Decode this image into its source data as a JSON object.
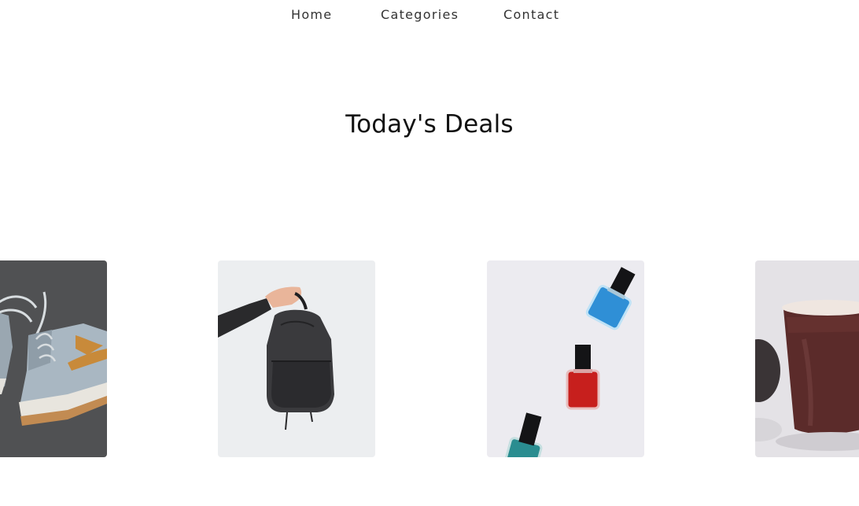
{
  "nav": {
    "items": [
      {
        "label": "Home"
      },
      {
        "label": "Categories"
      },
      {
        "label": "Contact"
      }
    ]
  },
  "deals": {
    "title": "Today's Deals",
    "products": [
      {
        "icon": "sneakers-image"
      },
      {
        "icon": "backpack-image"
      },
      {
        "icon": "nail-polish-image"
      },
      {
        "icon": "mug-image"
      }
    ]
  },
  "colors": {
    "text": "#111111",
    "nav_text": "#333333",
    "background": "#ffffff"
  }
}
